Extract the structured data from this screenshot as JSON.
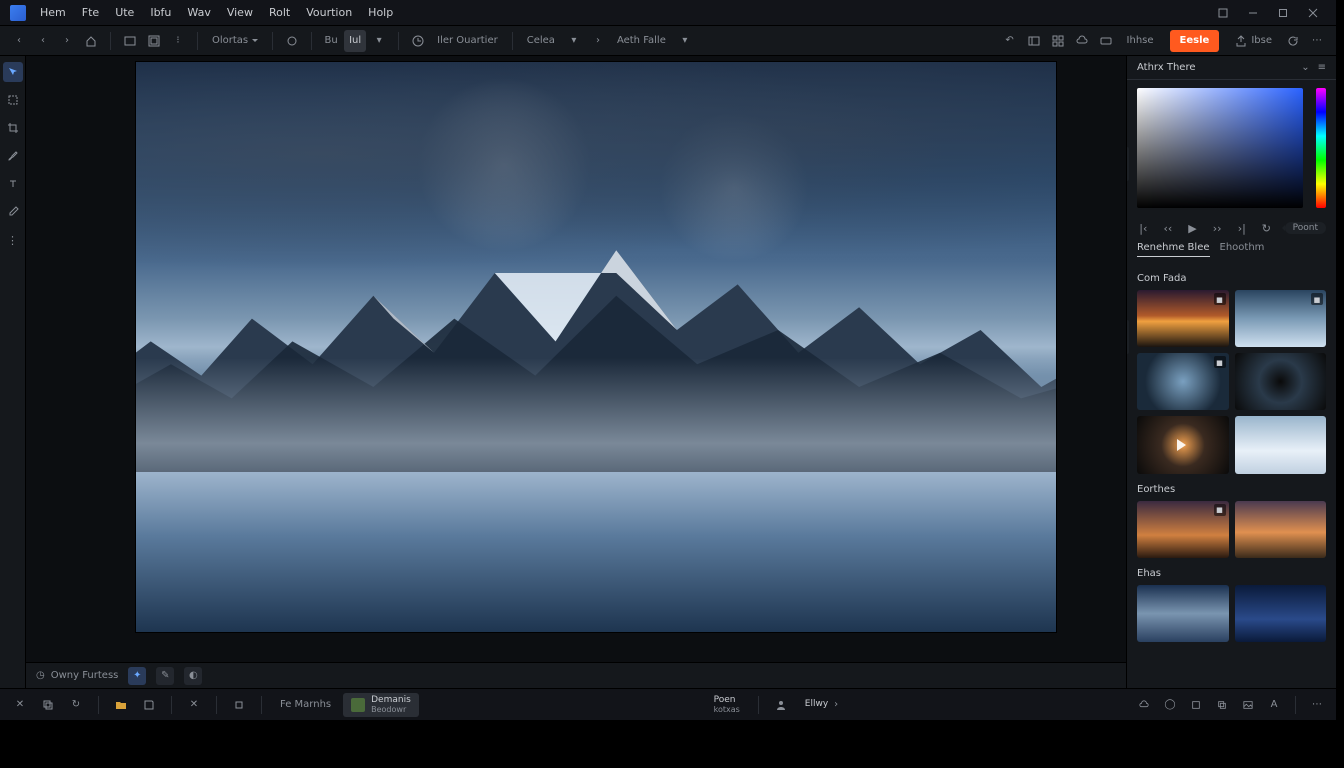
{
  "window": {
    "minimize": "–",
    "maximize": "□",
    "close": "×"
  },
  "menubar": {
    "items": [
      "Hem",
      "Fte",
      "Ute",
      "Ibfu",
      "Wav",
      "View",
      "Rolt",
      "Vourtion",
      "Holp"
    ]
  },
  "toolbar": {
    "options_label": "Olortas",
    "seg": {
      "a": "Bu",
      "b": "Iul"
    },
    "live_label": "Iler Ouartier",
    "group1": "Celea",
    "group2": "Aeth Falle",
    "action": "Eesle",
    "meta_label": "Ihhse",
    "share": "Ibse"
  },
  "right": {
    "header": "Athrx There",
    "reset_label": "Poont",
    "tabs": [
      "Renehme Blee",
      "Ehoothm"
    ],
    "sections": {
      "presets": "Com Fada",
      "favorites": "Eorthes",
      "others": "Ehas"
    }
  },
  "canvas_footer": {
    "label": "Owny Furtess"
  },
  "taskbar": {
    "label_left": "Fe  Marnhs",
    "chip1": {
      "line1": "Demanis",
      "line2": "Beodowr"
    },
    "chip2": {
      "line1": "Poen",
      "line2": "kotxas"
    },
    "chip3": {
      "line1": "Ellwy",
      "line2": ""
    }
  }
}
